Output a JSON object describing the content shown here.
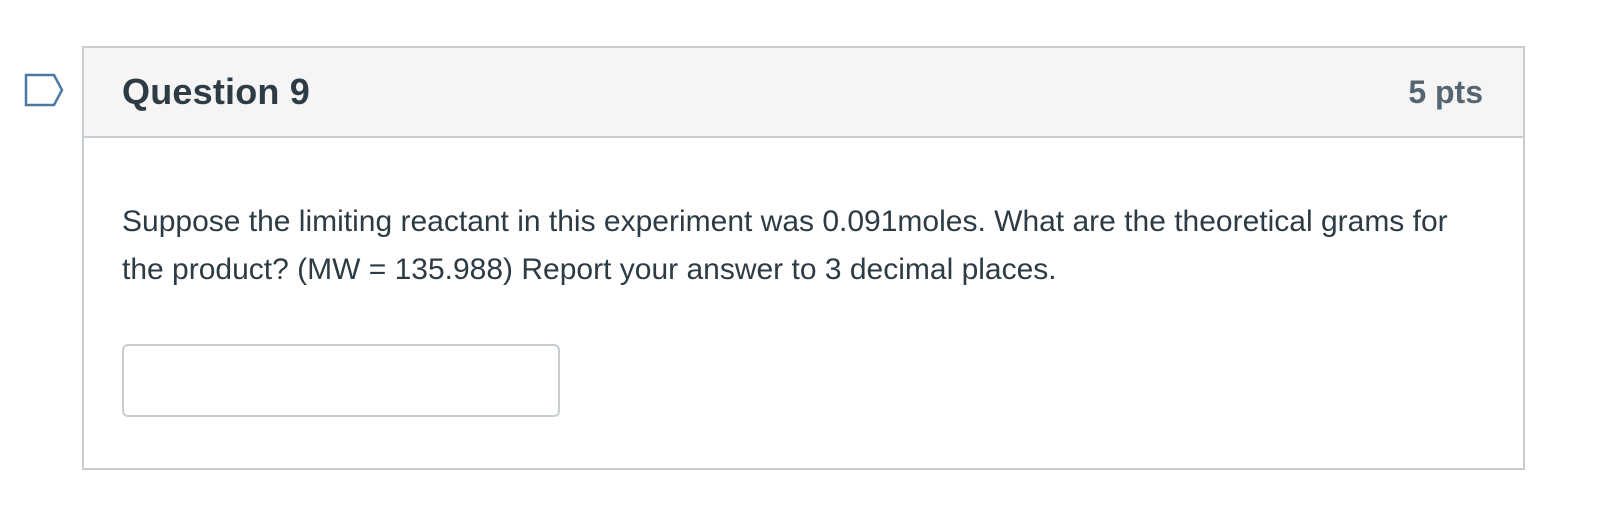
{
  "question": {
    "title": "Question 9",
    "points": "5 pts",
    "text": "Suppose the limiting reactant in this experiment was 0.091moles. What are the theoretical grams for the product? (MW = 135.988) Report your answer to 3 decimal places.",
    "answer_value": "",
    "flag_icon": "bookmark-flag-icon"
  },
  "colors": {
    "header_bg": "#f5f5f5",
    "border": "#c7cdd1",
    "text": "#2d3b45",
    "flag": "#4a7aa4"
  }
}
